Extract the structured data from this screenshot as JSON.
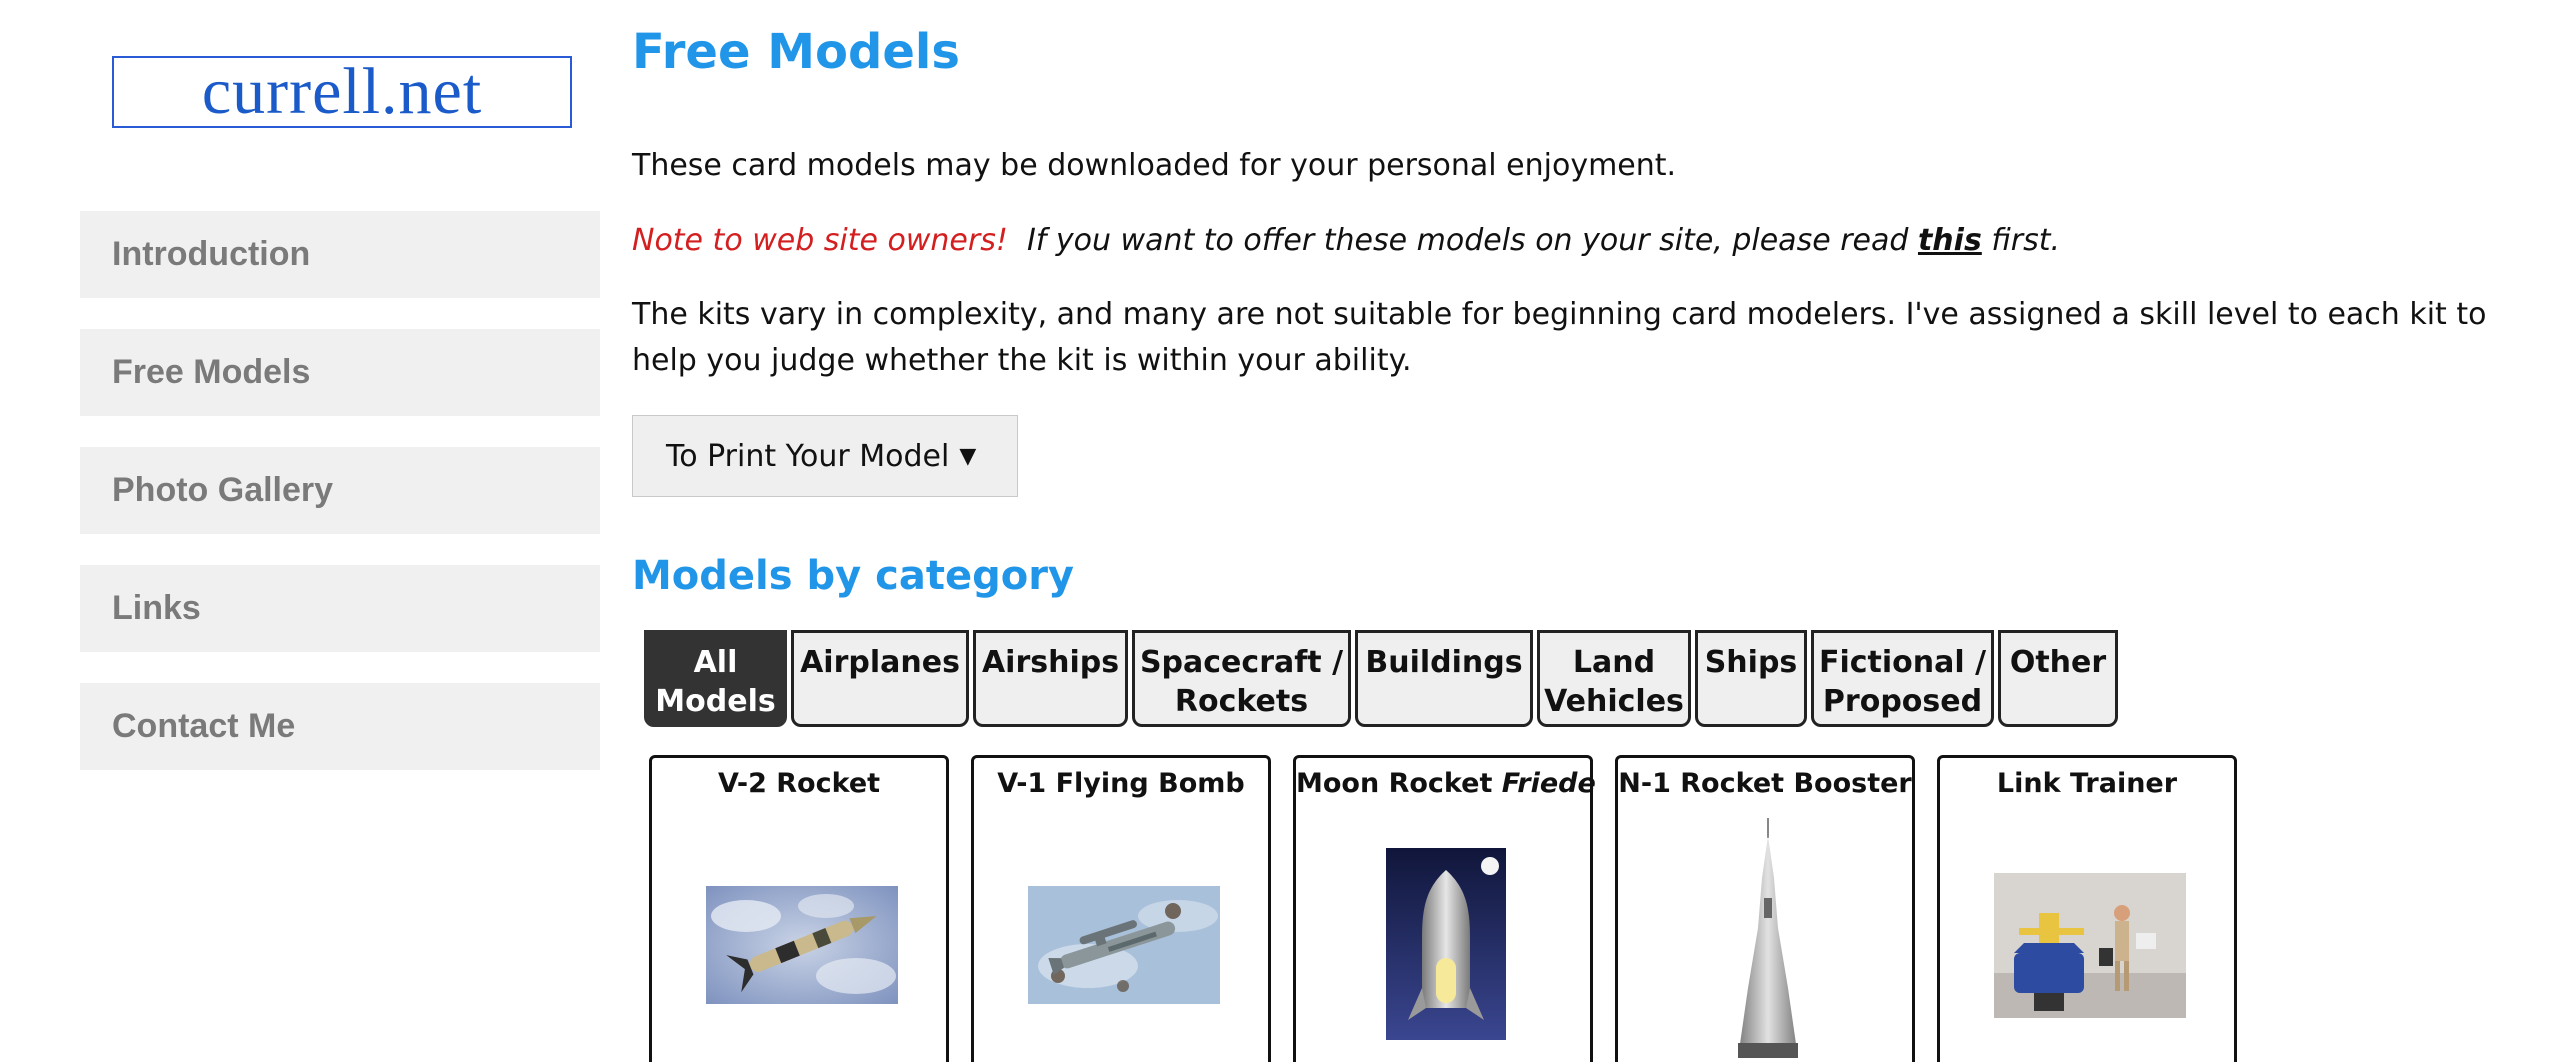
{
  "logo": {
    "text": "currell.net"
  },
  "nav": [
    {
      "label": "Introduction"
    },
    {
      "label": "Free Models"
    },
    {
      "label": "Photo Gallery"
    },
    {
      "label": "Links"
    },
    {
      "label": "Contact Me"
    }
  ],
  "main": {
    "title": "Free Models",
    "intro": "These card models may be downloaded for your personal enjoyment.",
    "note_label": "Note to web site owners!",
    "note_text_before": "If you want to offer these models on your site, please read",
    "note_link": "this",
    "note_text_after": "first.",
    "kits_text": "The kits vary in complexity, and many are not suitable for beginning card modelers. I've assigned a skill level to each kit to help you judge whether the kit is within your ability.",
    "print_button": "To Print Your Model",
    "category_heading": "Models by category"
  },
  "tabs": [
    {
      "label_1": "All",
      "label_2": "Models",
      "active": true
    },
    {
      "label_1": "Airplanes",
      "label_2": ""
    },
    {
      "label_1": "Airships",
      "label_2": ""
    },
    {
      "label_1": "Spacecraft /",
      "label_2": "Rockets"
    },
    {
      "label_1": "Buildings",
      "label_2": ""
    },
    {
      "label_1": "Land",
      "label_2": "Vehicles"
    },
    {
      "label_1": "Ships",
      "label_2": ""
    },
    {
      "label_1": "Fictional /",
      "label_2": "Proposed"
    },
    {
      "label_1": "Other",
      "label_2": ""
    }
  ],
  "cards": [
    {
      "title": "V-2 Rocket",
      "title_italic": ""
    },
    {
      "title": "V-1 Flying Bomb",
      "title_italic": ""
    },
    {
      "title": "Moon Rocket ",
      "title_italic": "Friede"
    },
    {
      "title": "N-1 Rocket Booster",
      "title_italic": ""
    },
    {
      "title": "Link Trainer",
      "title_italic": ""
    }
  ],
  "colors": {
    "accent": "#2196e8",
    "note": "#d31f1f",
    "nav_bg": "#f0f0f0",
    "nav_text": "#7a7a7a",
    "tab_active": "#333333"
  }
}
